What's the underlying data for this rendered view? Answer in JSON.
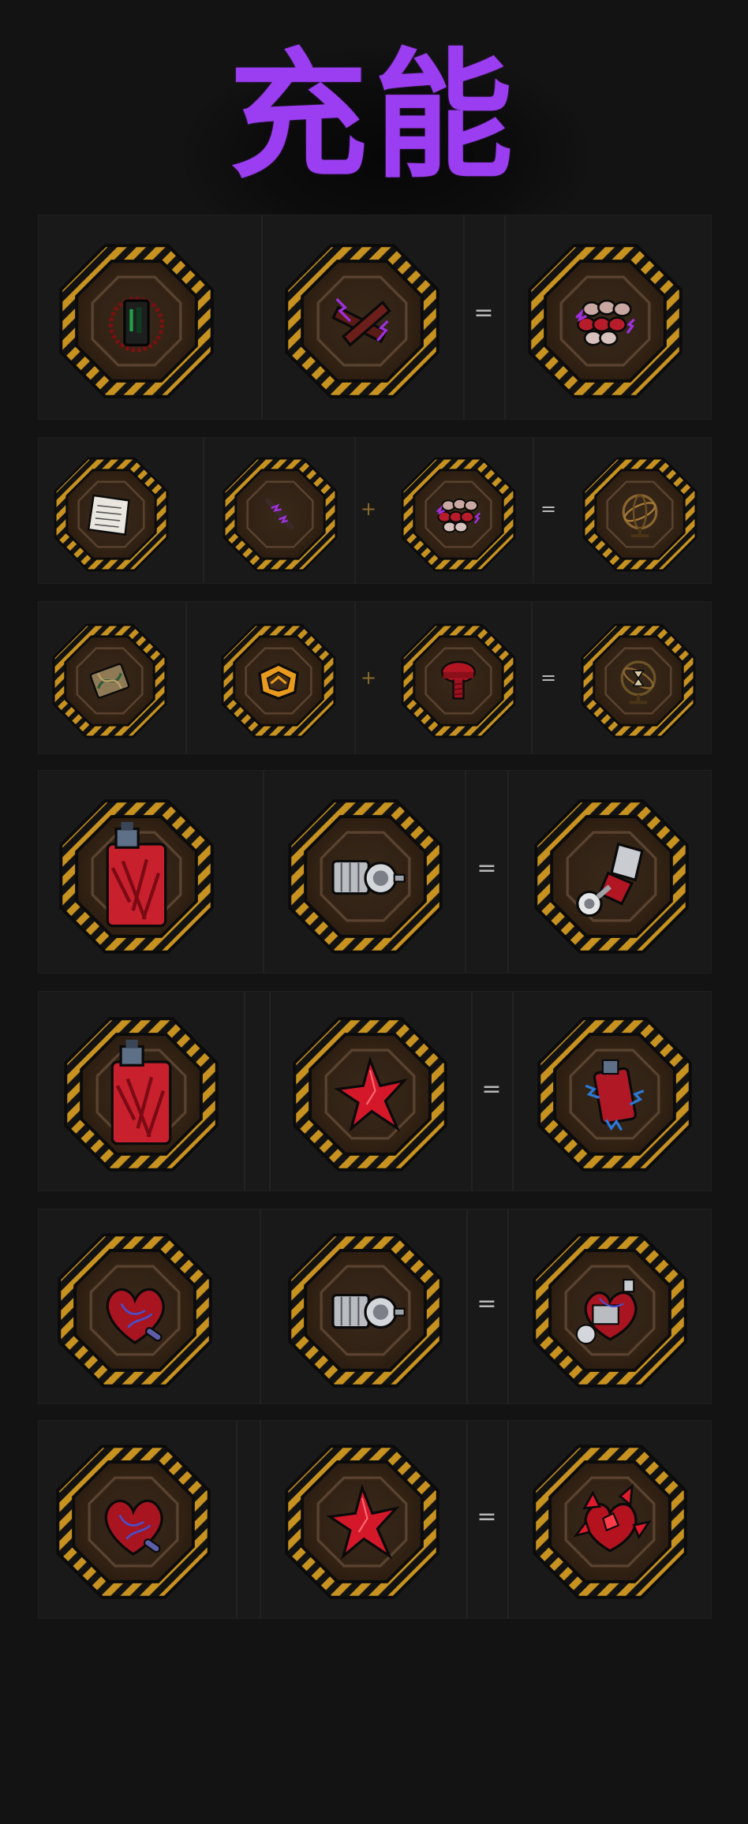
{
  "title": "充能",
  "colors": {
    "title": "#9b3df0",
    "stripe_yellow": "#c7921f",
    "stripe_black": "#121212",
    "slot_wood": "#3d2a18",
    "slot_inner": "#2a1d12",
    "red_item": "#d4212d",
    "purple_spark": "#a030e0",
    "blue_spark": "#2a7ad8"
  },
  "operators": {
    "equals": "=",
    "plus": "+"
  },
  "recipes": [
    {
      "id": "r1",
      "inputs": [
        "dark-machine-icon",
        "purple-charged-wood-icon"
      ],
      "output": "purple-charged-ammo-icon"
    },
    {
      "id": "r2",
      "catalyst": "newspaper-icon",
      "inputs": [
        "purple-charged-stick-icon",
        "purple-charged-ammo-icon"
      ],
      "output": "bronze-armillary-sphere-icon"
    },
    {
      "id": "r3",
      "catalyst": "dna-bandage-icon",
      "inputs": [
        "orange-badge-icon",
        "red-bolt-icon"
      ],
      "output": "hourglass-armillary-icon"
    },
    {
      "id": "r4",
      "inputs": [
        "red-flesh-canister-icon",
        "silver-motor-icon"
      ],
      "output": "flesh-motor-arm-icon"
    },
    {
      "id": "r5",
      "inputs": [
        "red-flesh-canister-icon",
        "red-crystal-shard-icon"
      ],
      "output": "blue-charged-canister-icon"
    },
    {
      "id": "r6",
      "inputs": [
        "red-heart-icon",
        "silver-motor-icon"
      ],
      "output": "mechanical-heart-icon"
    },
    {
      "id": "r7",
      "inputs": [
        "red-heart-icon",
        "red-crystal-shard-icon"
      ],
      "output": "crystal-heart-icon"
    }
  ]
}
